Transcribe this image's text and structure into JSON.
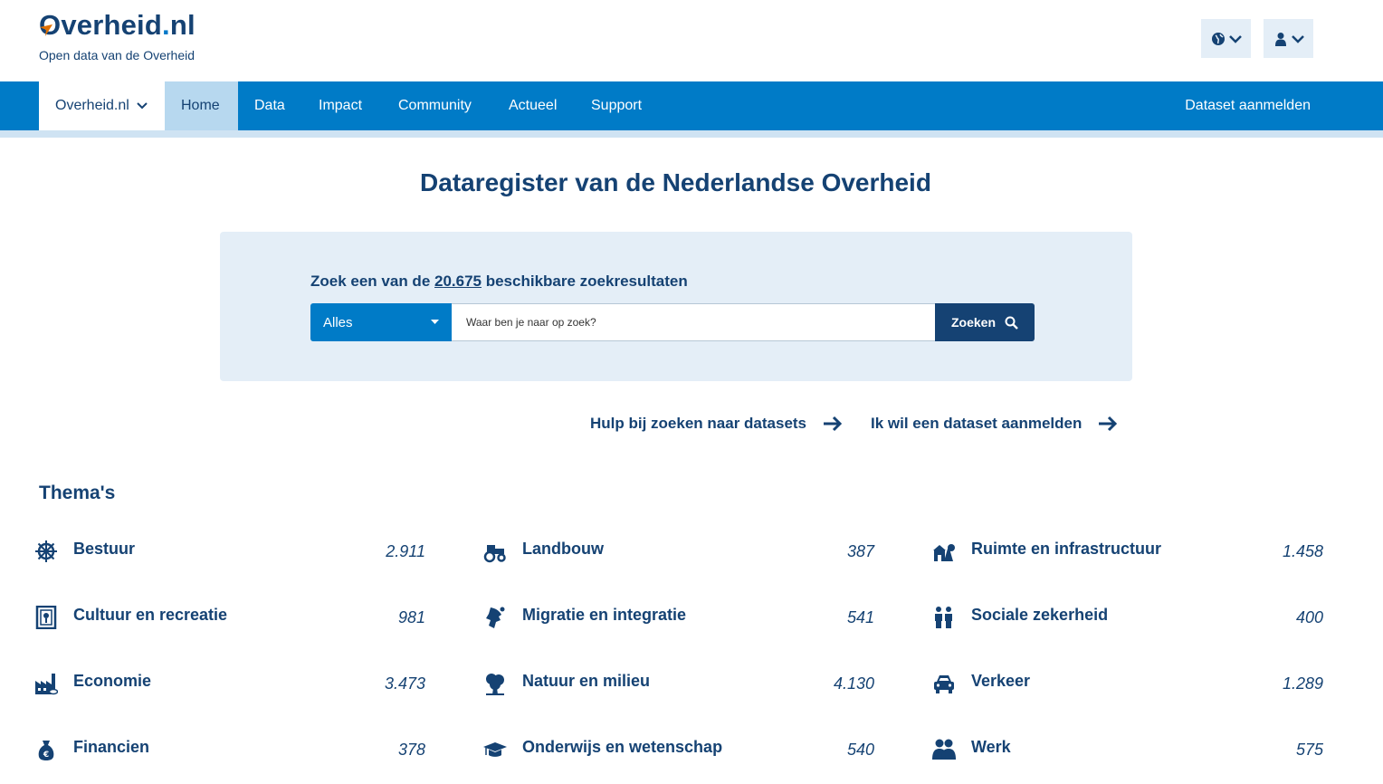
{
  "header": {
    "logo_main": "Overheid",
    "logo_dot": ".",
    "logo_tld": "nl",
    "tagline": "Open data van de Overheid",
    "language_icon": "globe-icon",
    "user_icon": "user-icon"
  },
  "nav": {
    "site_label": "Overheid.nl",
    "items": [
      {
        "label": "Home",
        "active": true
      },
      {
        "label": "Data"
      },
      {
        "label": "Impact"
      },
      {
        "label": "Community"
      },
      {
        "label": "Actueel"
      },
      {
        "label": "Support"
      }
    ],
    "right_label": "Dataset aanmelden"
  },
  "page": {
    "title": "Dataregister van de Nederlandse Overheid"
  },
  "search": {
    "intro_prefix": "Zoek een van de ",
    "count": "20.675",
    "intro_suffix": " beschikbare zoekresultaten",
    "scope_selected": "Alles",
    "placeholder": "Waar ben je naar op zoek?",
    "button_label": "Zoeken"
  },
  "links": {
    "help": "Hulp bij zoeken naar datasets",
    "register": "Ik wil een dataset aanmelden"
  },
  "themes": {
    "title": "Thema's",
    "items": [
      {
        "label": "Bestuur",
        "count": "2.911",
        "icon": "ship-wheel-icon"
      },
      {
        "label": "Landbouw",
        "count": "387",
        "icon": "tractor-icon"
      },
      {
        "label": "Ruimte en infrastructuur",
        "count": "1.458",
        "icon": "infrastructure-icon"
      },
      {
        "label": "Cultuur en recreatie",
        "count": "981",
        "icon": "painting-icon"
      },
      {
        "label": "Migratie en integratie",
        "count": "541",
        "icon": "migration-icon"
      },
      {
        "label": "Sociale zekerheid",
        "count": "400",
        "icon": "people-icon"
      },
      {
        "label": "Economie",
        "count": "3.473",
        "icon": "factory-icon"
      },
      {
        "label": "Natuur en milieu",
        "count": "4.130",
        "icon": "tree-icon"
      },
      {
        "label": "Verkeer",
        "count": "1.289",
        "icon": "car-icon"
      },
      {
        "label": "Financien",
        "count": "378",
        "icon": "money-bag-icon"
      },
      {
        "label": "Onderwijs en wetenschap",
        "count": "540",
        "icon": "graduation-cap-icon"
      },
      {
        "label": "Werk",
        "count": "575",
        "icon": "workers-icon"
      }
    ]
  },
  "colors": {
    "brand_dark": "#154273",
    "nav_blue": "#007bc7",
    "panel_bg": "#e4eef7"
  }
}
